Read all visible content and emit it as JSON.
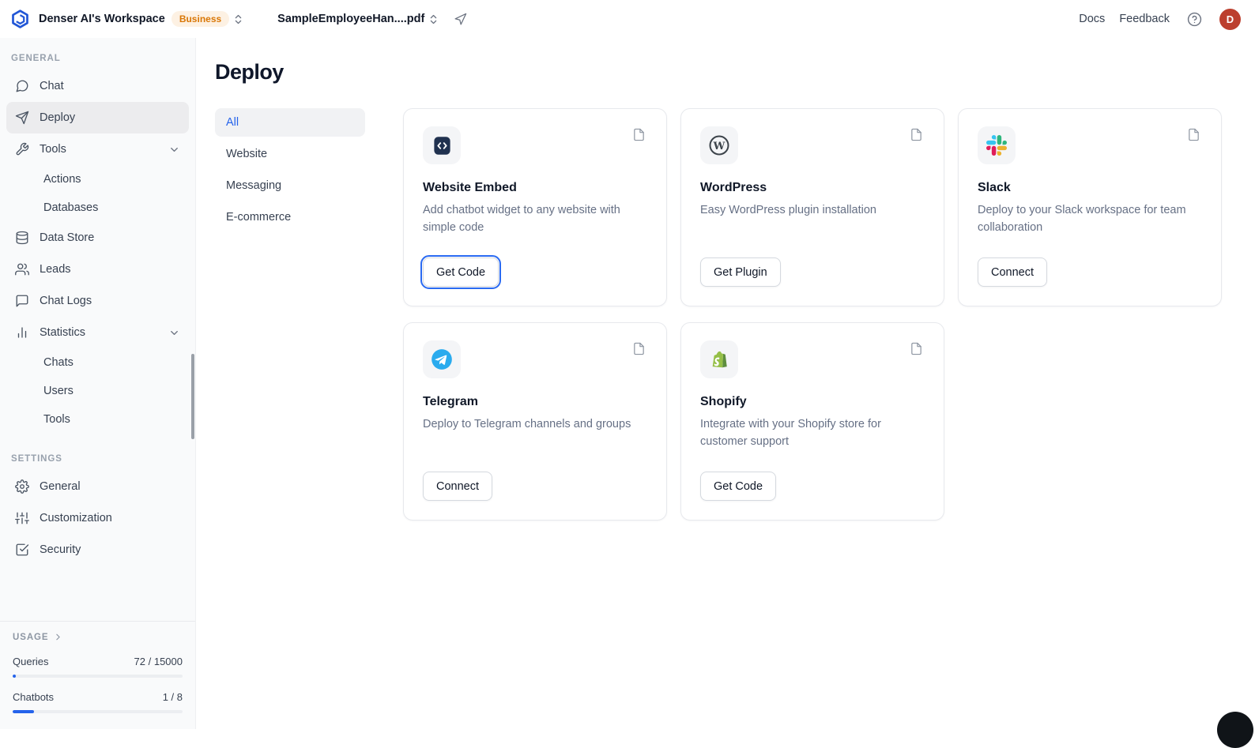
{
  "colors": {
    "accent_blue": "#2563eb",
    "badge_bg": "#fdf1e3",
    "badge_text": "#d97706",
    "avatar_bg": "#bc3f2e",
    "sidebar_bg": "#f9fafb",
    "active_item_bg": "#ececee",
    "telegram_blue": "#2AABEE",
    "shopify_green": "#95BF47",
    "wordpress_gray": "#3c434a",
    "slack_palette": [
      "#36C5F0",
      "#2EB67D",
      "#ECB22E",
      "#E01E5A"
    ]
  },
  "topbar": {
    "workspace_name": "Denser AI's Workspace",
    "plan_badge": "Business",
    "document_name": "SampleEmployeeHan....pdf",
    "docs_label": "Docs",
    "feedback_label": "Feedback",
    "avatar_initial": "D"
  },
  "sidebar": {
    "general_section": "GENERAL",
    "settings_section": "SETTINGS",
    "items": {
      "chat": "Chat",
      "deploy": "Deploy",
      "tools": "Tools",
      "actions": "Actions",
      "databases": "Databases",
      "data_store": "Data Store",
      "leads": "Leads",
      "chat_logs": "Chat Logs",
      "statistics": "Statistics",
      "stats_chats": "Chats",
      "stats_users": "Users",
      "stats_tools": "Tools",
      "general": "General",
      "customization": "Customization",
      "security": "Security"
    },
    "usage": {
      "label": "USAGE",
      "queries_label": "Queries",
      "queries_value": "72 / 15000",
      "queries_fill": "2%",
      "chatbots_label": "Chatbots",
      "chatbots_value": "1 / 8",
      "chatbots_fill": "12.5%"
    }
  },
  "main": {
    "title": "Deploy",
    "filters": {
      "all": "All",
      "website": "Website",
      "messaging": "Messaging",
      "ecommerce": "E-commerce"
    },
    "cards": [
      {
        "name": "Website Embed",
        "description": "Add chatbot widget to any website with simple code",
        "button": "Get Code"
      },
      {
        "name": "WordPress",
        "description": "Easy WordPress plugin installation",
        "button": "Get Plugin"
      },
      {
        "name": "Slack",
        "description": "Deploy to your Slack workspace for team collaboration",
        "button": "Connect"
      },
      {
        "name": "Telegram",
        "description": "Deploy to Telegram channels and groups",
        "button": "Connect"
      },
      {
        "name": "Shopify",
        "description": "Integrate with your Shopify store for customer support",
        "button": "Get Code"
      }
    ]
  }
}
